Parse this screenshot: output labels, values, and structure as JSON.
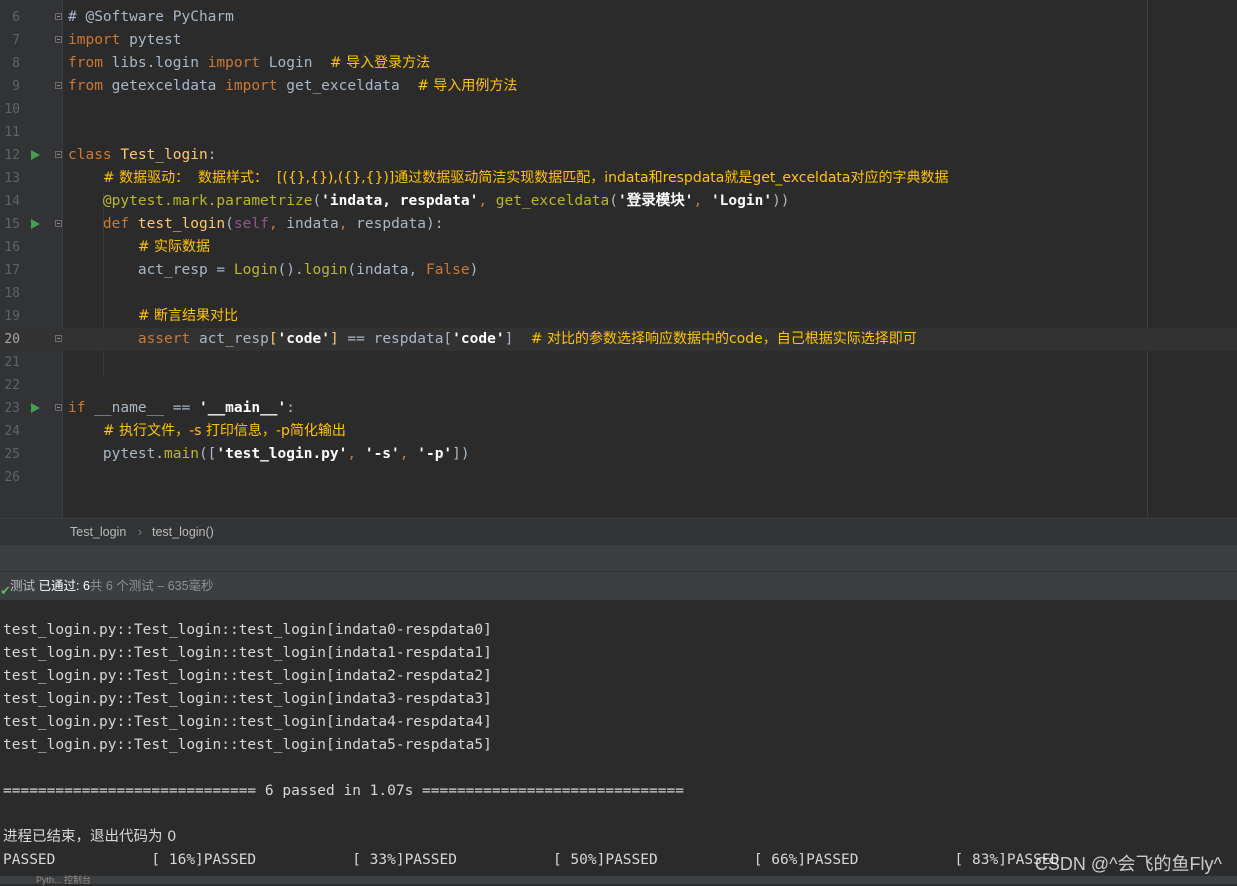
{
  "editor": {
    "lines": [
      {
        "n": "6",
        "tokens": [
          {
            "t": "# @Software PyCharm",
            "c": "cmt-plain"
          }
        ]
      },
      {
        "n": "7",
        "tokens": [
          {
            "t": "import",
            "c": "kw"
          },
          {
            "t": " pytest",
            "c": "id"
          }
        ]
      },
      {
        "n": "8",
        "tokens": [
          {
            "t": "from",
            "c": "kw"
          },
          {
            "t": " libs.login ",
            "c": "id"
          },
          {
            "t": "import",
            "c": "kw"
          },
          {
            "t": " Login  ",
            "c": "id"
          },
          {
            "t": "# 导入登录方法",
            "c": "cmt"
          }
        ]
      },
      {
        "n": "9",
        "tokens": [
          {
            "t": "from",
            "c": "kw"
          },
          {
            "t": " getexceldata ",
            "c": "id"
          },
          {
            "t": "import",
            "c": "kw"
          },
          {
            "t": " get_exceldata  ",
            "c": "id"
          },
          {
            "t": "# 导入用例方法",
            "c": "cmt"
          }
        ]
      },
      {
        "n": "10",
        "tokens": []
      },
      {
        "n": "11",
        "tokens": []
      },
      {
        "n": "12",
        "tokens": [
          {
            "t": "class",
            "c": "kw"
          },
          {
            "t": " ",
            "c": "id"
          },
          {
            "t": "Test_login",
            "c": "cls"
          },
          {
            "t": ":",
            "c": "id"
          }
        ]
      },
      {
        "n": "13",
        "tokens": [
          {
            "t": "    ",
            "c": "id"
          },
          {
            "t": "# 数据驱动：  数据样式：  [({},{}),({},{})]通过数据驱动简洁实现数据匹配，indata和respdata就是get_exceldata对应的字典数据",
            "c": "cmt"
          }
        ]
      },
      {
        "n": "14",
        "tokens": [
          {
            "t": "    ",
            "c": "id"
          },
          {
            "t": "@pytest.mark.parametrize",
            "c": "dec"
          },
          {
            "t": "(",
            "c": "id"
          },
          {
            "t": "'indata, respdata'",
            "c": "str"
          },
          {
            "t": ", ",
            "c": "kw"
          },
          {
            "t": "get_exceldata",
            "c": "dec"
          },
          {
            "t": "(",
            "c": "id"
          },
          {
            "t": "'登录模块'",
            "c": "str"
          },
          {
            "t": ", ",
            "c": "kw"
          },
          {
            "t": "'Login'",
            "c": "str"
          },
          {
            "t": "))",
            "c": "id"
          }
        ]
      },
      {
        "n": "15",
        "tokens": [
          {
            "t": "    ",
            "c": "id"
          },
          {
            "t": "def",
            "c": "kw"
          },
          {
            "t": " ",
            "c": "id"
          },
          {
            "t": "test_login",
            "c": "fn"
          },
          {
            "t": "(",
            "c": "id"
          },
          {
            "t": "self",
            "c": "self"
          },
          {
            "t": ", ",
            "c": "kw"
          },
          {
            "t": "indata",
            "c": "id"
          },
          {
            "t": ", ",
            "c": "kw"
          },
          {
            "t": "respdata",
            "c": "id"
          },
          {
            "t": "):",
            "c": "id"
          }
        ]
      },
      {
        "n": "16",
        "tokens": [
          {
            "t": "        ",
            "c": "id"
          },
          {
            "t": "# 实际数据",
            "c": "cmt"
          }
        ]
      },
      {
        "n": "17",
        "tokens": [
          {
            "t": "        act_resp = ",
            "c": "id"
          },
          {
            "t": "Login",
            "c": "dec"
          },
          {
            "t": "().",
            "c": "id"
          },
          {
            "t": "login",
            "c": "dec"
          },
          {
            "t": "(indata, ",
            "c": "id"
          },
          {
            "t": "False",
            "c": "kw"
          },
          {
            "t": ")",
            "c": "id"
          }
        ]
      },
      {
        "n": "18",
        "tokens": []
      },
      {
        "n": "19",
        "tokens": [
          {
            "t": "        ",
            "c": "id"
          },
          {
            "t": "# 断言结果对比",
            "c": "cmt"
          }
        ]
      },
      {
        "n": "20",
        "tokens": [
          {
            "t": "        ",
            "c": "id"
          },
          {
            "t": "assert",
            "c": "kw"
          },
          {
            "t": " act_resp",
            "c": "id"
          },
          {
            "t": "[",
            "c": "cls"
          },
          {
            "t": "'code'",
            "c": "str"
          },
          {
            "t": "]",
            "c": "cls"
          },
          {
            "t": " == respdata[",
            "c": "id"
          },
          {
            "t": "'code'",
            "c": "str"
          },
          {
            "t": "]  ",
            "c": "id"
          },
          {
            "t": "# 对比的参数选择响应数据中的code，自己根据实际选择即可",
            "c": "cmt"
          }
        ],
        "current": true
      },
      {
        "n": "21",
        "tokens": []
      },
      {
        "n": "22",
        "tokens": []
      },
      {
        "n": "23",
        "tokens": [
          {
            "t": "if",
            "c": "kw"
          },
          {
            "t": " __name__ == ",
            "c": "id"
          },
          {
            "t": "'__main__'",
            "c": "str"
          },
          {
            "t": ":",
            "c": "id"
          }
        ]
      },
      {
        "n": "24",
        "tokens": [
          {
            "t": "    ",
            "c": "id"
          },
          {
            "t": "# 执行文件，-s 打印信息，-p简化输出",
            "c": "cmt"
          }
        ]
      },
      {
        "n": "25",
        "tokens": [
          {
            "t": "    pytest.",
            "c": "id"
          },
          {
            "t": "main",
            "c": "dec"
          },
          {
            "t": "([",
            "c": "id"
          },
          {
            "t": "'test_login.py'",
            "c": "str"
          },
          {
            "t": ", ",
            "c": "kw"
          },
          {
            "t": "'-s'",
            "c": "str"
          },
          {
            "t": ", ",
            "c": "kw"
          },
          {
            "t": "'-p'",
            "c": "str"
          },
          {
            "t": "])",
            "c": "id"
          }
        ]
      },
      {
        "n": "26",
        "tokens": []
      }
    ]
  },
  "breadcrumb": {
    "class_name": "Test_login",
    "separator": "›",
    "method_name": "test_login()"
  },
  "test_status": {
    "label_prefix": "测试",
    "passed": "已通过: 6",
    "total": "共 6 个测试 – 635毫秒"
  },
  "console": {
    "results": [
      "test_login.py::Test_login::test_login[indata0-respdata0]",
      "test_login.py::Test_login::test_login[indata1-respdata1]",
      "test_login.py::Test_login::test_login[indata2-respdata2]",
      "test_login.py::Test_login::test_login[indata3-respdata3]",
      "test_login.py::Test_login::test_login[indata4-respdata4]",
      "test_login.py::Test_login::test_login[indata5-respdata5]"
    ],
    "summary": "============================= 6 passed in 1.07s ==============================",
    "exit_message": "进程已结束，退出代码为 0",
    "progress": "PASSED           [ 16%]PASSED           [ 33%]PASSED           [ 50%]PASSED           [ 66%]PASSED           [ 83%]PASSED"
  },
  "bottom_fragment": "Pyth... 控制台",
  "watermark": "CSDN @^会飞的鱼Fly^"
}
